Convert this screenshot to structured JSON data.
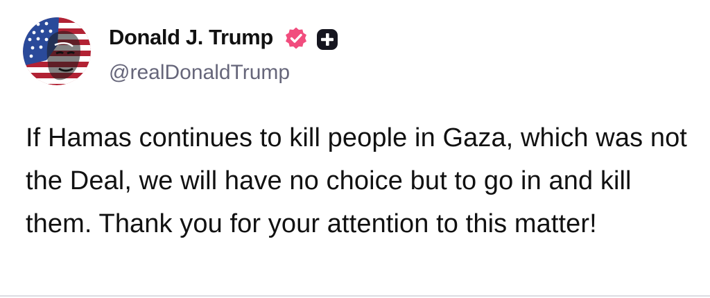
{
  "post": {
    "author": {
      "display_name": "Donald J. Trump",
      "handle": "@realDonaldTrump",
      "avatar_icon": "flag-portrait-avatar",
      "verified_icon": "verified-badge-icon",
      "verified_color": "#f14d7e",
      "extra_badge_icon": "plus-badge-icon"
    },
    "body": "If Hamas continues to kill people in Gaza, which was not the Deal, we will have no choice but to go in and kill them. Thank you for your attention to this matter!"
  },
  "colors": {
    "text": "#111111",
    "handle": "#66667a",
    "divider": "#dcdce2"
  }
}
